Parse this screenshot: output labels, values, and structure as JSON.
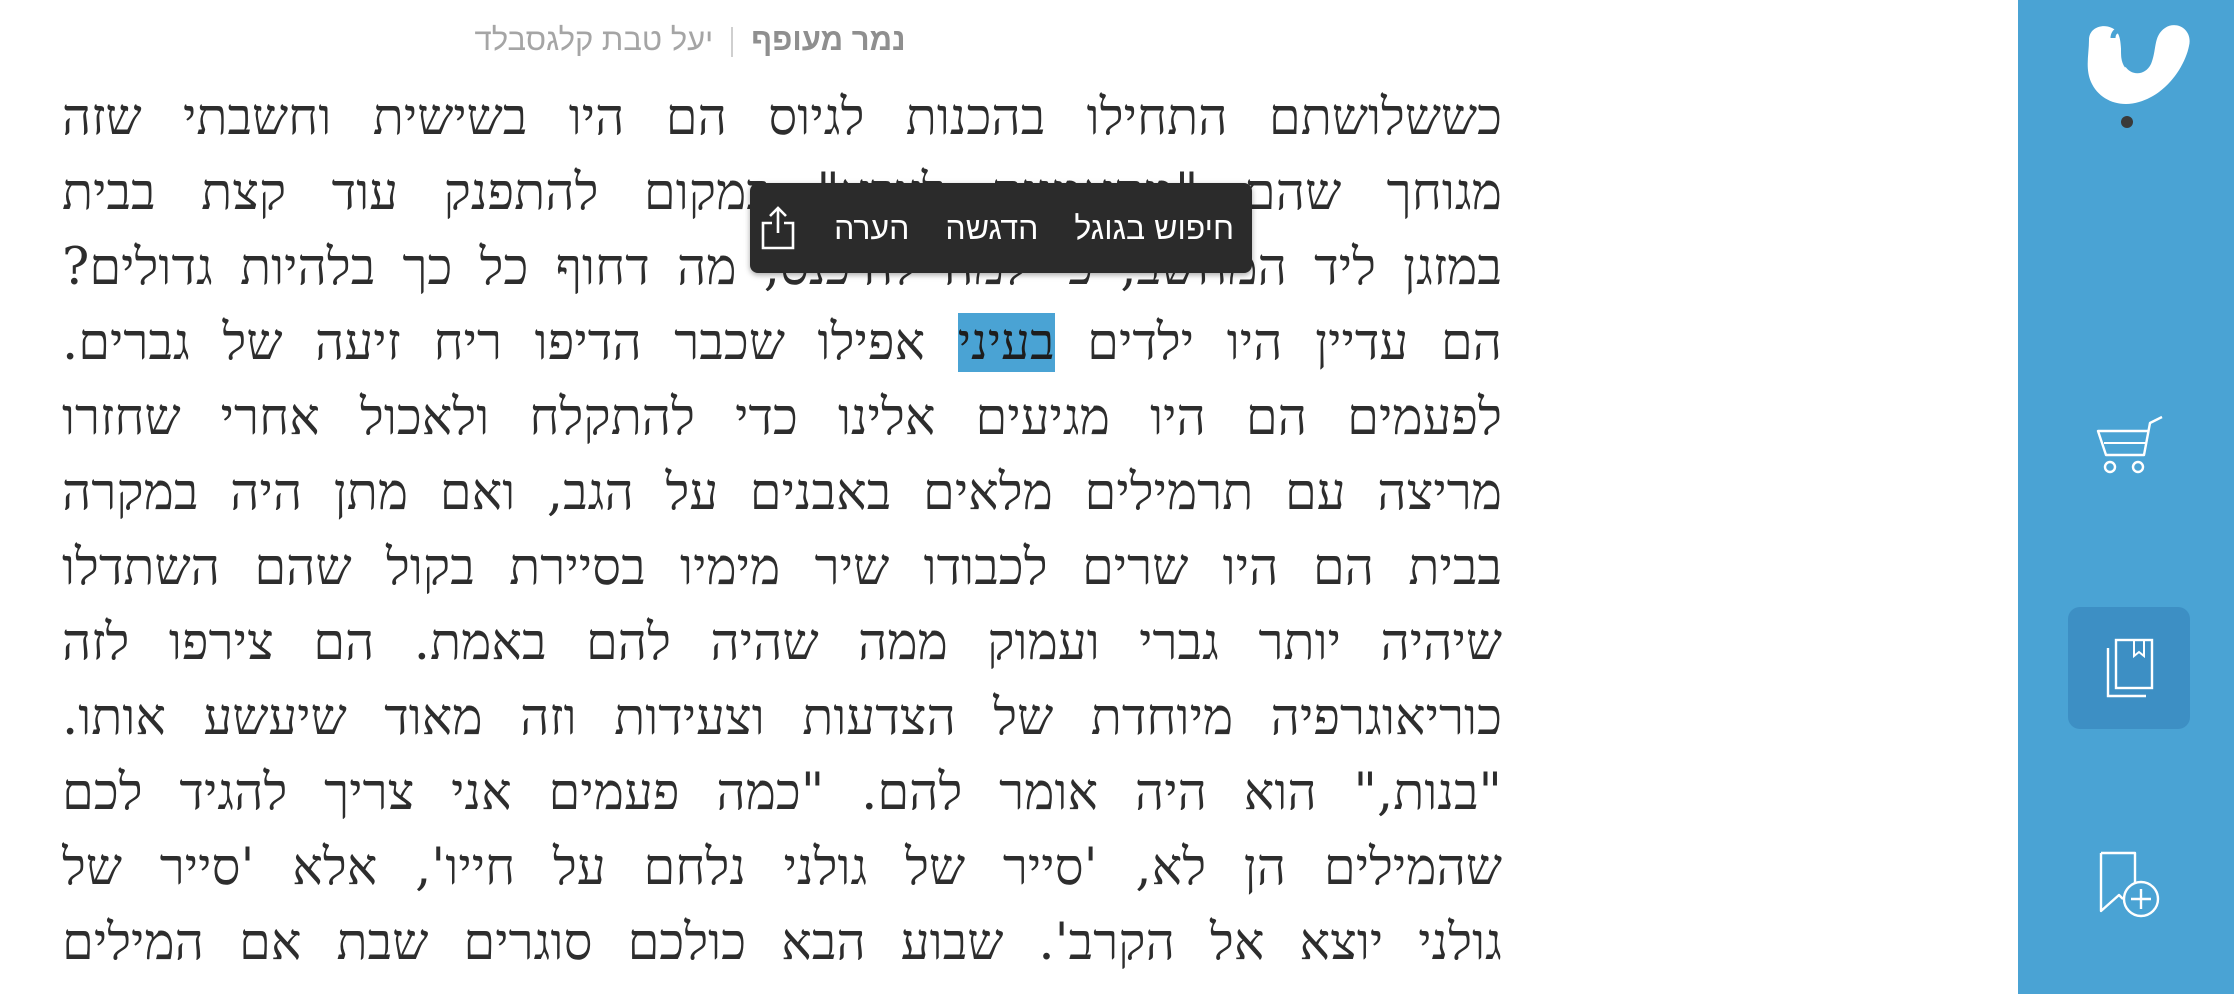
{
  "header": {
    "book_title": "נמר מעופף",
    "author": "יעל טבת קלגסבלד"
  },
  "text": {
    "lines": [
      "כששלושתם התחילו בהכנות לגיוס הם היו בשישית וחשבתי שזה",
      "מגוחך שהם \"מתאמנים לצבא\" במקום להתפנק עוד קצת בבית",
      "במזגן ליד המחשב, כי למה להיכנס, מה דחוף כל כך בלהיות גדולים?",
      "הם עדיין היו ילדים",
      "לפעמים הם היו מגיעים אלינו כדי להתקלח ולאכול אחרי שחזרו",
      "מריצה עם תרמילים מלאים באבנים על הגב, ואם מתן היה במקרה",
      "בבית הם היו שרים לכבודו שיר מימיו בסיירת בקול שהם השתדלו",
      "שיהיה יותר גברי ועמוק ממה שהיה להם באמת. הם צירפו לזה",
      "כוריאוגרפיה מיוחדת של הצדעות וצעידות וזה מאוד שיעשע אותו.",
      "\"בנות,\" הוא היה אומר להם. \"כמה פעמים אני צריך להגיד לכם",
      "שהמילים הן לא, 'סייר של גולני נלחם על חייו', אלא 'סייר של",
      "גולני יוצא אל הקרב'. שבוע הבא כולכם סוגרים שבת אם המילים"
    ],
    "line4_before": "הם עדיין היו ילדים ",
    "line4_highlight": "בעיני",
    "line4_after": " אפילו שכבר הדיפו ריח זיעה של גברים."
  },
  "popup": {
    "google_search": "חיפוש בגוגל",
    "highlight": "הדגשה",
    "note": "הערה",
    "share_icon": "share-icon"
  },
  "sidebar": {
    "logo_icon": "steimatzky-logo-icon",
    "cart_icon": "cart-icon",
    "library_icon": "library-icon",
    "bookmark_icon": "add-bookmark-icon"
  },
  "colors": {
    "sidebar": "#4aa3d4",
    "sidebar_active": "#3d8fc4",
    "highlight": "#4aa3d4",
    "popup": "#2b2b2b"
  }
}
